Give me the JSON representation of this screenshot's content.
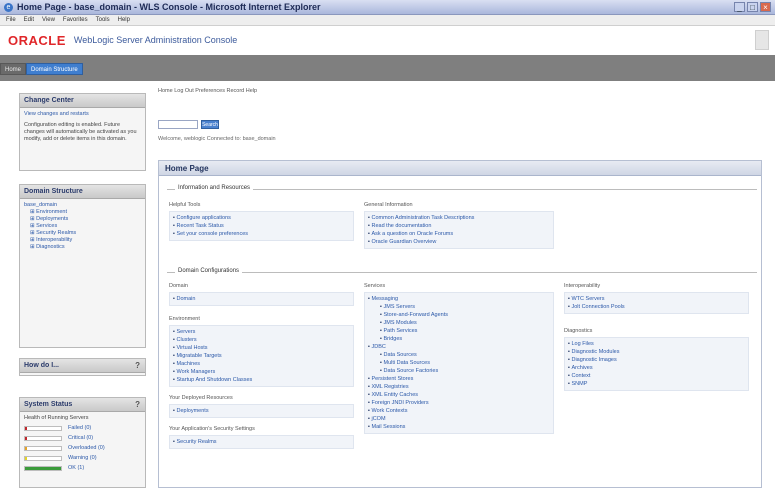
{
  "window": {
    "title": "Home Page - base_domain - WLS Console - Microsoft Internet Explorer",
    "menu": [
      "File",
      "Edit",
      "View",
      "Favorites",
      "Tools",
      "Help"
    ]
  },
  "header": {
    "logo": "ORACLE",
    "product": "WebLogic Server Administration Console"
  },
  "toolbar": {
    "tabs": [
      "Home",
      "Domain Structure"
    ],
    "active_tab": 1
  },
  "change_center": {
    "title": "Change Center",
    "link": "View changes and restarts",
    "text": "Configuration editing is enabled. Future changes will automatically be activated as you modify, add or delete items in this domain."
  },
  "domain_structure": {
    "title": "Domain Structure",
    "items": [
      {
        "label": "base_domain",
        "sub": false
      },
      {
        "label": "Environment",
        "sub": true
      },
      {
        "label": "Deployments",
        "sub": true
      },
      {
        "label": "Services",
        "sub": true
      },
      {
        "label": "Security Realms",
        "sub": true
      },
      {
        "label": "Interoperability",
        "sub": true
      },
      {
        "label": "Diagnostics",
        "sub": true
      }
    ]
  },
  "how_do_i": {
    "title": "How do I..."
  },
  "system_status": {
    "title": "System Status",
    "subtitle": "Health of Running Servers",
    "rows": [
      {
        "label": "Failed (0)",
        "color": "#c0262b",
        "fraction": 0.05
      },
      {
        "label": "Critical (0)",
        "color": "#c0262b",
        "fraction": 0.05
      },
      {
        "label": "Overloaded (0)",
        "color": "#e4a327",
        "fraction": 0.05
      },
      {
        "label": "Warning (0)",
        "color": "#e4d327",
        "fraction": 0.05
      },
      {
        "label": "OK (1)",
        "color": "#3a9b3a",
        "fraction": 1.0
      }
    ]
  },
  "main": {
    "breadcrumb": "Home Log Out Preferences Record Help",
    "actions": [
      "Home",
      "Log Out",
      "Preferences",
      "Record",
      "Help"
    ],
    "search_button": "Search",
    "welcome": "Welcome, weblogic    Connected to: base_domain",
    "home_title": "Home Page",
    "info_section": {
      "title": "Information and Resources",
      "helpful_title": "Helpful Tools",
      "helpful": [
        "Configure applications",
        "Recent Task Status",
        "Set your console preferences"
      ],
      "general_title": "General Information",
      "general": [
        "Common Administration Task Descriptions",
        "Read the documentation",
        "Ask a question on Oracle Forums",
        "Oracle Guardian Overview"
      ]
    },
    "domain_section": {
      "title": "Domain Configurations",
      "domain_title": "Domain",
      "domain_items": [
        "Domain"
      ],
      "environment_title": "Environment",
      "environment_items": [
        "Servers",
        "Clusters",
        "Virtual Hosts",
        "Migratable Targets",
        "Machines",
        "Work Managers",
        "Startup And Shutdown Classes"
      ],
      "deployed_title": "Your Deployed Resources",
      "deployed_items": [
        "Deployments"
      ],
      "app_security_title": "Your Application's Security Settings",
      "app_security_items": [
        "Security Realms"
      ],
      "services_title": "Services",
      "services_items": [
        {
          "label": "Messaging",
          "sub": false
        },
        {
          "label": "JMS Servers",
          "sub": true
        },
        {
          "label": "Store-and-Forward Agents",
          "sub": true
        },
        {
          "label": "JMS Modules",
          "sub": true
        },
        {
          "label": "Path Services",
          "sub": true
        },
        {
          "label": "Bridges",
          "sub": true
        },
        {
          "label": "JDBC",
          "sub": false
        },
        {
          "label": "Data Sources",
          "sub": true
        },
        {
          "label": "Multi Data Sources",
          "sub": true
        },
        {
          "label": "Data Source Factories",
          "sub": true
        },
        {
          "label": "Persistent Stores",
          "sub": false
        },
        {
          "label": "XML Registries",
          "sub": false
        },
        {
          "label": "XML Entity Caches",
          "sub": false
        },
        {
          "label": "Foreign JNDI Providers",
          "sub": false
        },
        {
          "label": "Work Contexts",
          "sub": false
        },
        {
          "label": "jCOM",
          "sub": false
        },
        {
          "label": "Mail Sessions",
          "sub": false
        }
      ],
      "interop_title": "Interoperability",
      "interop_items": [
        "WTC Servers",
        "Jolt Connection Pools"
      ],
      "diag_title": "Diagnostics",
      "diag_items": [
        "Log Files",
        "Diagnostic Modules",
        "Diagnostic Images",
        "Archives",
        "Context",
        "SNMP"
      ]
    }
  }
}
